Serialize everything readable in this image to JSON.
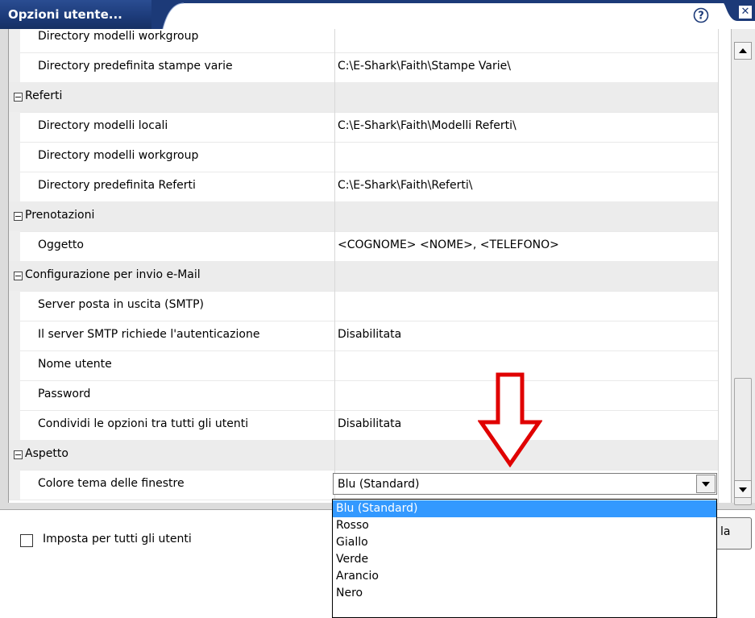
{
  "window": {
    "title": "Opzioni utente...",
    "help_icon": "help-question-icon",
    "close_icon": "close-x-icon"
  },
  "grid": {
    "rows": [
      {
        "type": "item",
        "label": "Directory modelli workgroup",
        "value": ""
      },
      {
        "type": "item",
        "label": "Directory predefinita stampe varie",
        "value": "C:\\E-Shark\\Faith\\Stampe Varie\\"
      },
      {
        "type": "category",
        "label": "Referti"
      },
      {
        "type": "item",
        "label": "Directory modelli locali",
        "value": "C:\\E-Shark\\Faith\\Modelli Referti\\"
      },
      {
        "type": "item",
        "label": "Directory modelli workgroup",
        "value": ""
      },
      {
        "type": "item",
        "label": "Directory predefinita Referti",
        "value": "C:\\E-Shark\\Faith\\Referti\\"
      },
      {
        "type": "category",
        "label": "Prenotazioni"
      },
      {
        "type": "item",
        "label": "Oggetto",
        "value": "<COGNOME> <NOME>, <TELEFONO>"
      },
      {
        "type": "category",
        "label": "Configurazione per invio e-Mail"
      },
      {
        "type": "item",
        "label": "Server posta in uscita (SMTP)",
        "value": ""
      },
      {
        "type": "item",
        "label": "Il server SMTP richiede l'autenticazione",
        "value": "Disabilitata"
      },
      {
        "type": "item",
        "label": "Nome utente",
        "value": ""
      },
      {
        "type": "item",
        "label": "Password",
        "value": ""
      },
      {
        "type": "item",
        "label": "Condividi le opzioni tra tutti gli utenti",
        "value": "Disabilitata"
      },
      {
        "type": "category",
        "label": "Aspetto"
      },
      {
        "type": "item",
        "label": "Colore tema delle finestre",
        "value": ""
      }
    ]
  },
  "theme_combo": {
    "selected": "Blu (Standard)",
    "options": [
      "Blu (Standard)",
      "Rosso",
      "Giallo",
      "Verde",
      "Arancio",
      "Nero"
    ],
    "highlighted": "Blu (Standard)"
  },
  "footer": {
    "checkbox_label": "Imposta per tutti gli utenti",
    "button_label_partial": "la"
  },
  "colors": {
    "title_bar": "#1c3a78",
    "selection": "#3399ff",
    "annotation_arrow": "#e00000"
  }
}
